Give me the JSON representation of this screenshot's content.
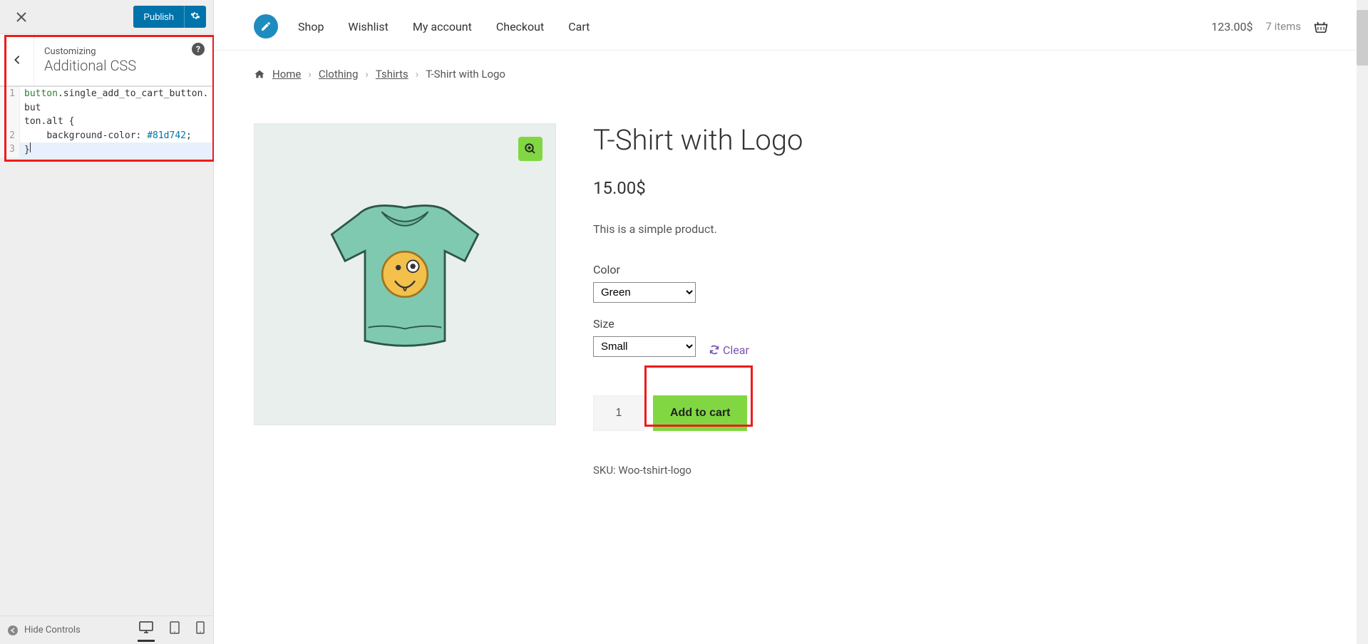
{
  "customizer": {
    "publish_label": "Publish",
    "sup": "Customizing",
    "title": "Additional CSS",
    "code_lines": [
      "button.single_add_to_cart_button.button.alt {",
      "    background-color: #81d742;",
      "}"
    ],
    "hide_controls": "Hide Controls"
  },
  "nav": {
    "items": [
      "Shop",
      "Wishlist",
      "My account",
      "Checkout",
      "Cart"
    ]
  },
  "cart": {
    "total": "123.00$",
    "items_text": "7 items"
  },
  "breadcrumb": {
    "home": "Home",
    "cat1": "Clothing",
    "cat2": "Tshirts",
    "current": "T-Shirt with Logo"
  },
  "product": {
    "title": "T-Shirt with Logo",
    "price": "15.00$",
    "desc": "This is a simple product.",
    "color_label": "Color",
    "color_value": "Green",
    "size_label": "Size",
    "size_value": "Small",
    "clear": "Clear",
    "qty": "1",
    "add_label": "Add to cart",
    "sku_label": "SKU: ",
    "sku_value": "Woo-tshirt-logo"
  },
  "colors": {
    "accent": "#81d742",
    "link": "#7952b3"
  }
}
